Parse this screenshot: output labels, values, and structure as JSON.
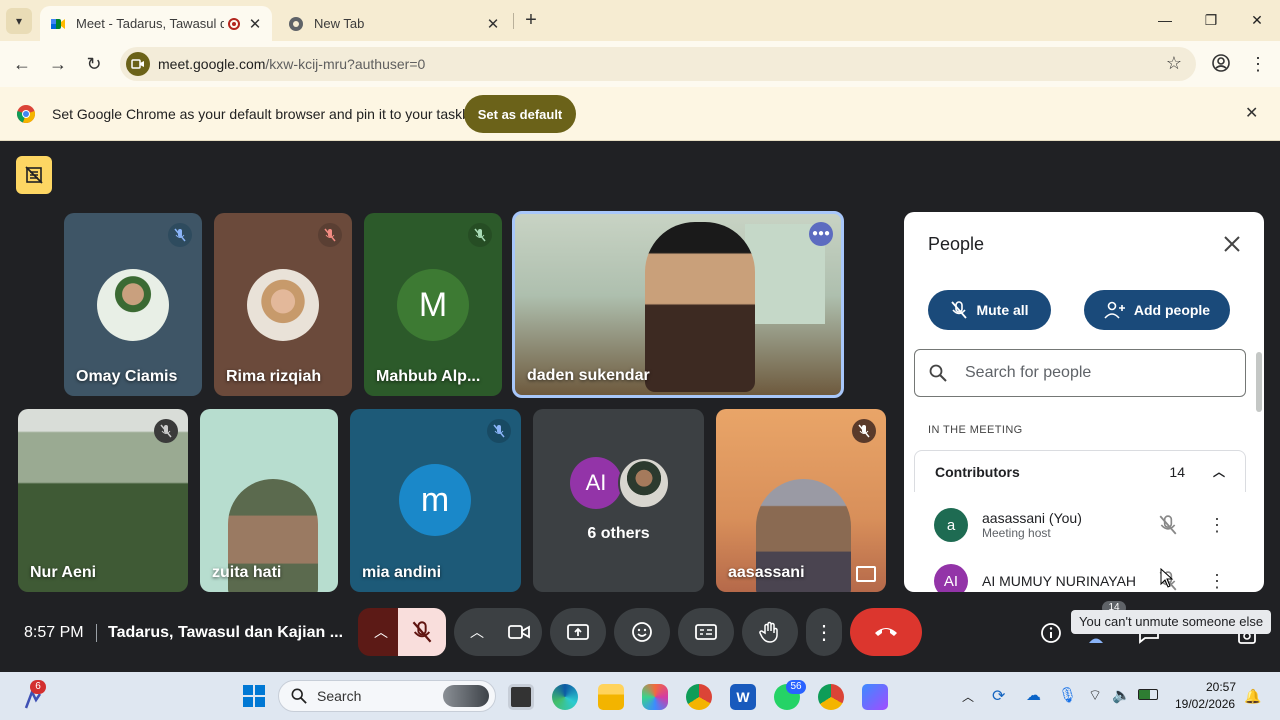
{
  "browser": {
    "tabs": [
      {
        "title": "Meet - Tadarus, Tawasul dan",
        "active": true
      },
      {
        "title": "New Tab",
        "active": false
      }
    ],
    "url_domain": "meet.google.com",
    "url_path": "/kxw-kcij-mru?authuser=0",
    "infobar_text": "Set Google Chrome as your default browser and pin it to your taskbar",
    "infobar_button": "Set as default"
  },
  "meeting": {
    "tiles": [
      {
        "name": "Omay Ciamis"
      },
      {
        "name": "Rima rizqiah"
      },
      {
        "name": "Mahbub Alp...",
        "initial": "M"
      },
      {
        "name": "daden sukendar"
      },
      {
        "name": "Nur Aeni"
      },
      {
        "name": "zuita hati"
      },
      {
        "name": "mia andini",
        "initial": "m"
      },
      {
        "name": "6 others",
        "initial": "AI"
      },
      {
        "name": "aasassani"
      }
    ],
    "time": "8:57 PM",
    "title": "Tadarus, Tawasul dan Kajian ...",
    "people_badge": "14",
    "tooltip": "You can't unmute someone else"
  },
  "people_panel": {
    "title": "People",
    "mute_all": "Mute all",
    "add_people": "Add people",
    "search_placeholder": "Search for people",
    "section_label": "IN THE MEETING",
    "group_label": "Contributors",
    "group_count": "14",
    "participants": [
      {
        "initial": "a",
        "name": "aasassani (You)",
        "role": "Meeting host",
        "color": "#1e6b52"
      },
      {
        "initial": "AI",
        "name": "AI MUMUY NURINAYAH",
        "role": "",
        "color": "#9334a8"
      }
    ]
  },
  "taskbar": {
    "search_label": "Search",
    "whatsapp_badge": "56",
    "left_badge": "6",
    "clock_time": "20:57",
    "clock_date": "19/02/2026"
  },
  "colors": {
    "meet_bg": "#202124",
    "end_call": "#dc362e",
    "accent_blue": "#1a4a7a",
    "chrome_frame": "#f6ecd2"
  }
}
